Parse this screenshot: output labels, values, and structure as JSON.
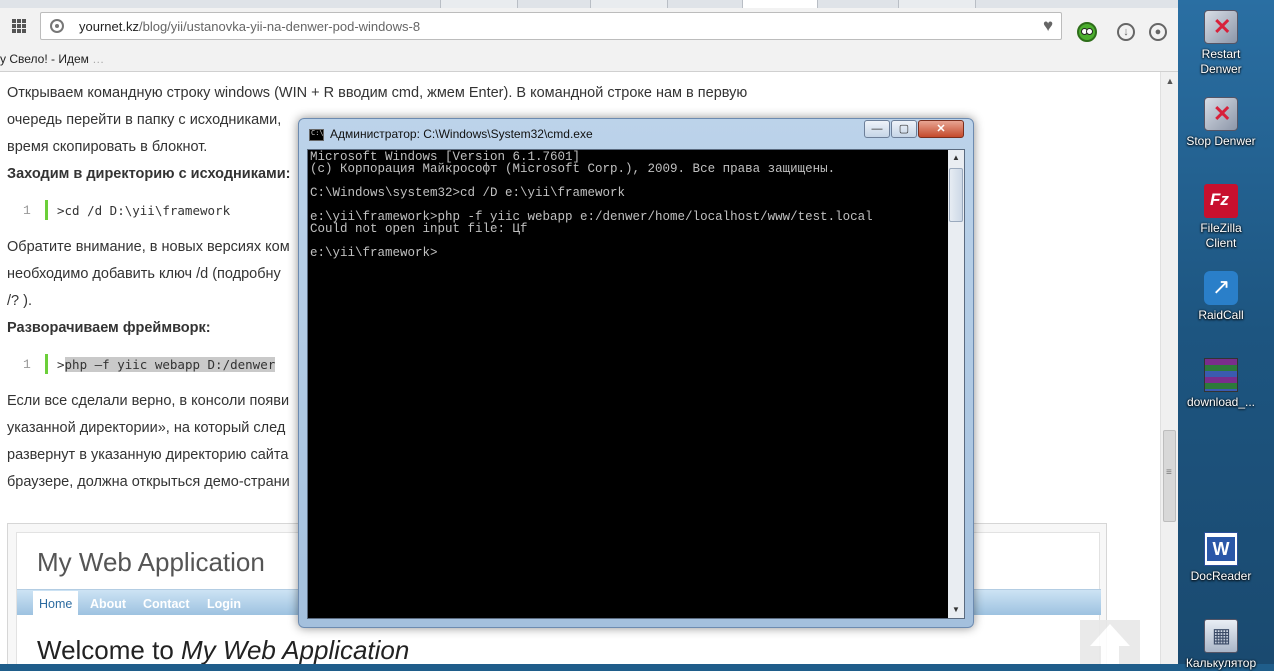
{
  "browser": {
    "url_host": "yournet.kz",
    "url_path": "/blog/yii/ustanovka-yii-na-denwer-pod-windows-8",
    "bookmark_text": "у Свело! - Идем",
    "bookmark_faded": " …"
  },
  "article": {
    "p1_line1": "Открываем командную строку windows (WIN + R вводим cmd, жмем Enter). В командной строке нам в первую",
    "p1_line2": "очередь перейти в папку с исходниками,",
    "p1_line3": "время скопировать в блокнот.",
    "heading1": "Заходим в директорию с исходниками:",
    "code1_num": "1",
    "code1": ">cd /d D:\\yii\\framework",
    "p2_line1": "Обратите внимание, в новых версиях ком",
    "p2_line2": "необходимо добавить ключ /d (подробну",
    "p2_line3": "/? ).",
    "heading2": "Разворачиваем фреймворк:",
    "code2_num": "1",
    "code2_prefix": ">",
    "code2": "php –f yiic webapp D:/denwer",
    "p3_line1": "Если все сделали верно, в консоли появи",
    "p3_line2": "указанной директории», на который след",
    "p3_line3": "развернут в указанную директорию сайта",
    "p3_line4": "браузере, должна открыться демо-страни"
  },
  "demo": {
    "title": "My Web Application",
    "menu": [
      "Home",
      "About",
      "Contact",
      "Login"
    ],
    "welcome_prefix": "Welcome to ",
    "welcome_app": "My Web Application"
  },
  "cmd": {
    "title": "Администратор: C:\\Windows\\System32\\cmd.exe",
    "minimize": "—",
    "maximize": "▢",
    "close": "✕",
    "output": "Microsoft Windows [Version 6.1.7601]\n(c) Корпорация Майкрософт (Microsoft Corp.), 2009. Все права защищены.\n\nC:\\Windows\\system32>cd /D e:\\yii\\framework\n\ne:\\yii\\framework>php -f yiic webapp e:/denwer/home/localhost/www/test.local\nCould not open input file: Цf\n\ne:\\yii\\framework>"
  },
  "desktop_icons": [
    {
      "label": "Restart\nDenwer",
      "icon": "denver-restart-icon"
    },
    {
      "label": "Stop Denwer",
      "icon": "denver-stop-icon"
    },
    {
      "label": "FileZilla\nClient",
      "icon": "filezilla-icon"
    },
    {
      "label": "RaidCall",
      "icon": "raidcall-icon"
    },
    {
      "label": "download_...",
      "icon": "winrar-icon"
    },
    {
      "label": "DocReader",
      "icon": "docreader-icon"
    },
    {
      "label": "Калькулятор",
      "icon": "calculator-icon"
    }
  ]
}
